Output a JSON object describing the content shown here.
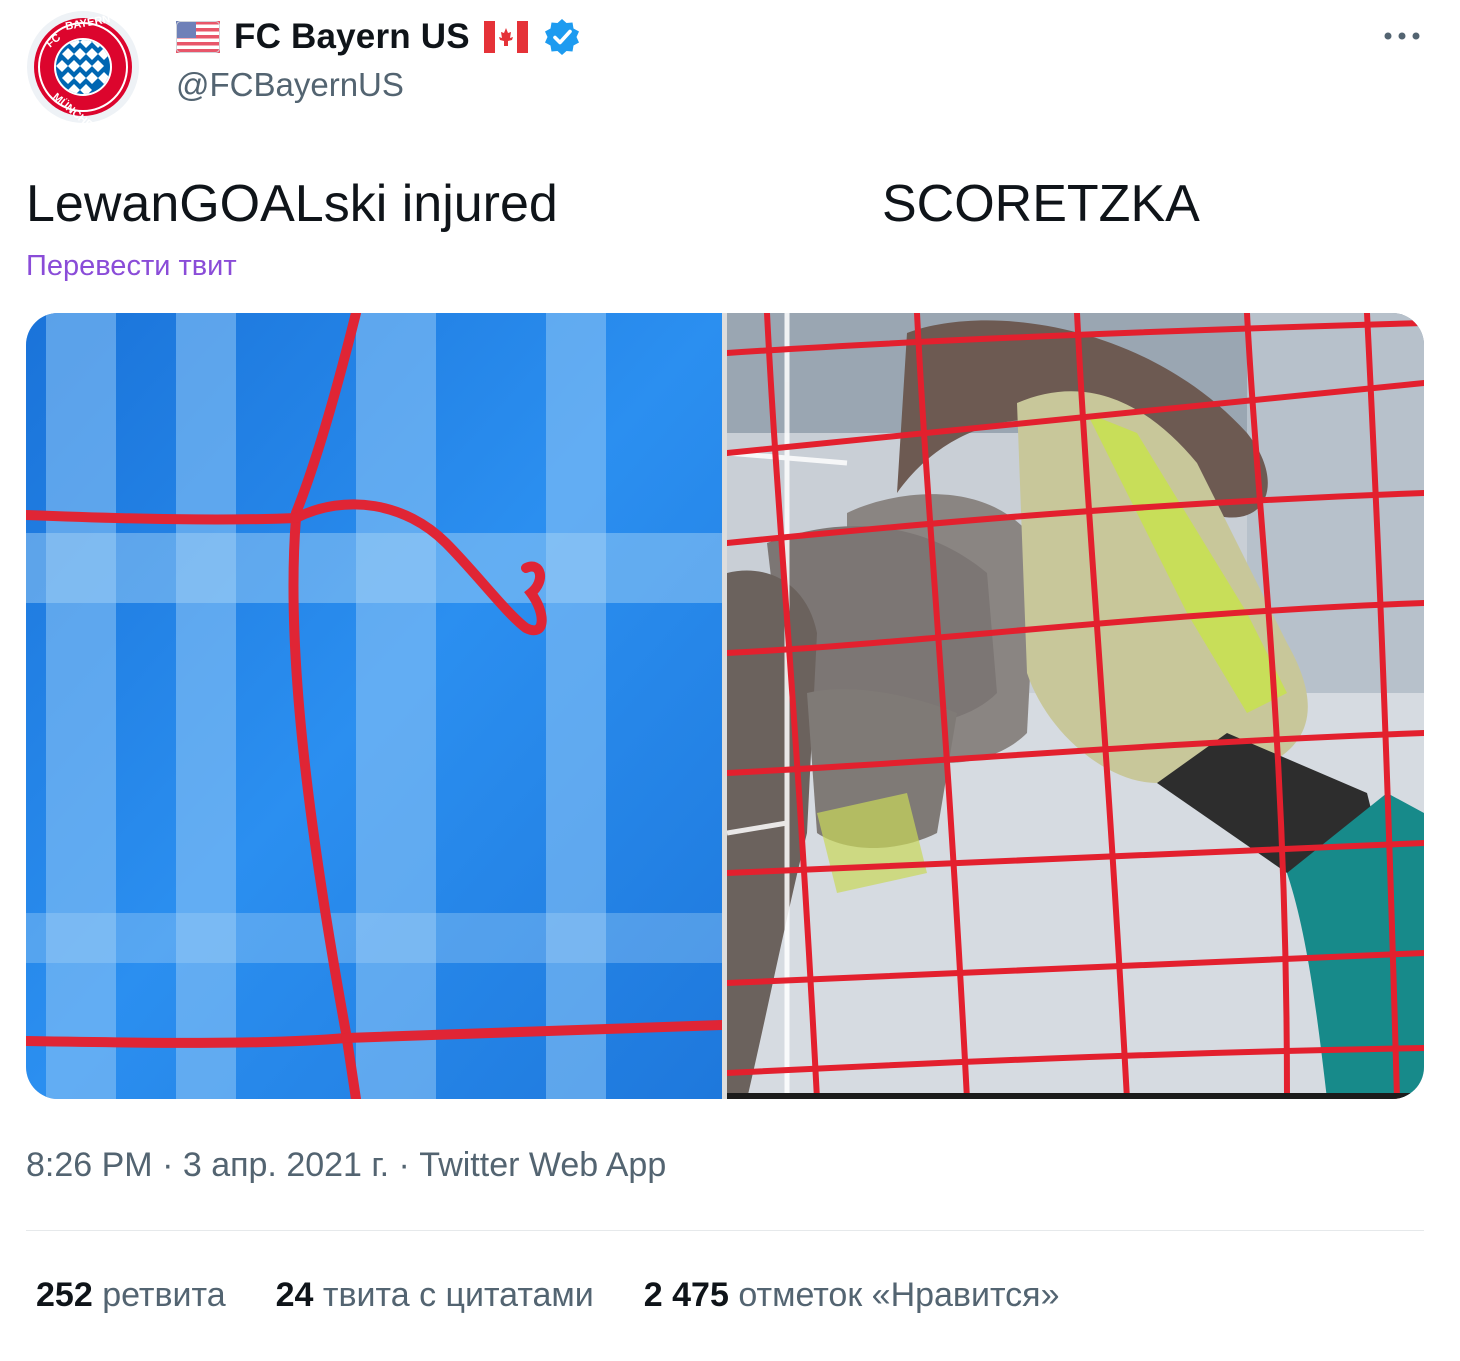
{
  "tweet": {
    "author": {
      "display_name": "FC Bayern US",
      "handle": "@FCBayernUS",
      "verified": true,
      "flags": [
        "us-flag-icon",
        "canada-flag-icon"
      ],
      "avatar": "fc-bayern-munchen-logo"
    },
    "text_left": "LewanGOALski injured",
    "text_right": "SCORETZKA",
    "translate_label": "Перевести твит",
    "media": {
      "left": "net-broken-strand-photo",
      "right": "goalkeeper-gloves-in-net-photo"
    },
    "meta": "8:26 PM · 3 апр. 2021 г. · Twitter Web App",
    "stats": [
      {
        "count": "252",
        "label": "ретвита"
      },
      {
        "count": "24",
        "label": "твита с цитатами"
      },
      {
        "count": "2 475",
        "label": "отметок «Нравится»"
      }
    ]
  },
  "colors": {
    "verified": "#1d9bf0",
    "translate_link": "#8a4cd8",
    "secondary_text": "#536471",
    "net_red": "#e02535"
  }
}
